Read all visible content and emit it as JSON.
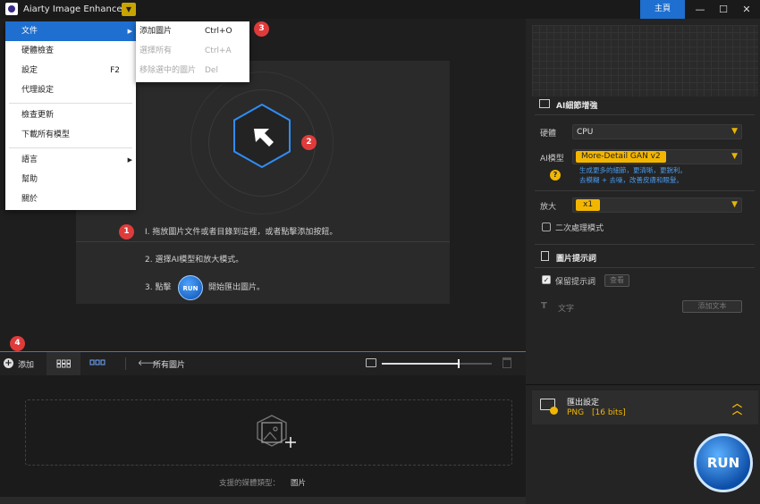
{
  "app": {
    "title": "Aiarty Image Enhancer",
    "home_label": "主頁"
  },
  "window_controls": {
    "minimize": "—",
    "maximize": "☐",
    "close": "✕"
  },
  "menu": {
    "items": [
      {
        "label": "文件",
        "shortcut": ""
      },
      {
        "label": "硬體檢查",
        "shortcut": ""
      },
      {
        "label": "設定",
        "shortcut": "F2"
      },
      {
        "label": "代理設定",
        "shortcut": ""
      },
      {
        "label": "檢查更新",
        "shortcut": ""
      },
      {
        "label": "下載所有模型",
        "shortcut": ""
      },
      {
        "label": "語言",
        "shortcut": ""
      },
      {
        "label": "幫助",
        "shortcut": ""
      },
      {
        "label": "關於",
        "shortcut": ""
      }
    ],
    "submenu": [
      {
        "label": "添加圖片",
        "shortcut": "Ctrl+O"
      },
      {
        "label": "選擇所有",
        "shortcut": "Ctrl+A"
      },
      {
        "label": "移除選中的圖片",
        "shortcut": "Del"
      }
    ]
  },
  "badges": [
    "1",
    "2",
    "3",
    "4",
    "5"
  ],
  "steps": {
    "step1": "I. 拖放圖片文件或者目錄到這裡，或者點擊添加按鈕。",
    "step2": "2. 選擇AI模型和放大模式。",
    "step3_prefix": "3. 點擊",
    "step3_run": "RUN",
    "step3_suffix": "開始匯出圖片。"
  },
  "toolbar": {
    "add_label": "添加",
    "all_images": "所有圖片",
    "zoom_level": 0.7
  },
  "bottom": {
    "support_label": "支援的媒體類型：",
    "support_value": "圖片"
  },
  "right": {
    "ai_section_title": "AI細節增強",
    "hardware_label": "硬體",
    "hardware_value": "CPU",
    "ai_model_label": "AI模型",
    "ai_model_value": "More-Detail GAN v2",
    "ai_model_desc1": "生成更多的細節，更清晰，更銳利。",
    "ai_model_desc2": "去模糊 + 去噪，改善皮膚和眼髮。",
    "help_icon": "?",
    "scale_label": "放大",
    "scale_value": "x1",
    "second_pass_label": "二次處理模式",
    "prompt_section_title": "圖片提示詞",
    "keep_prompt_label": "保留提示詞",
    "view_btn": "查看",
    "text_label": "文字",
    "add_text_btn": "添加文本",
    "export_title": "匯出設定",
    "export_format": "PNG",
    "export_bits": "[16 bits]",
    "run_label": "RUN"
  }
}
